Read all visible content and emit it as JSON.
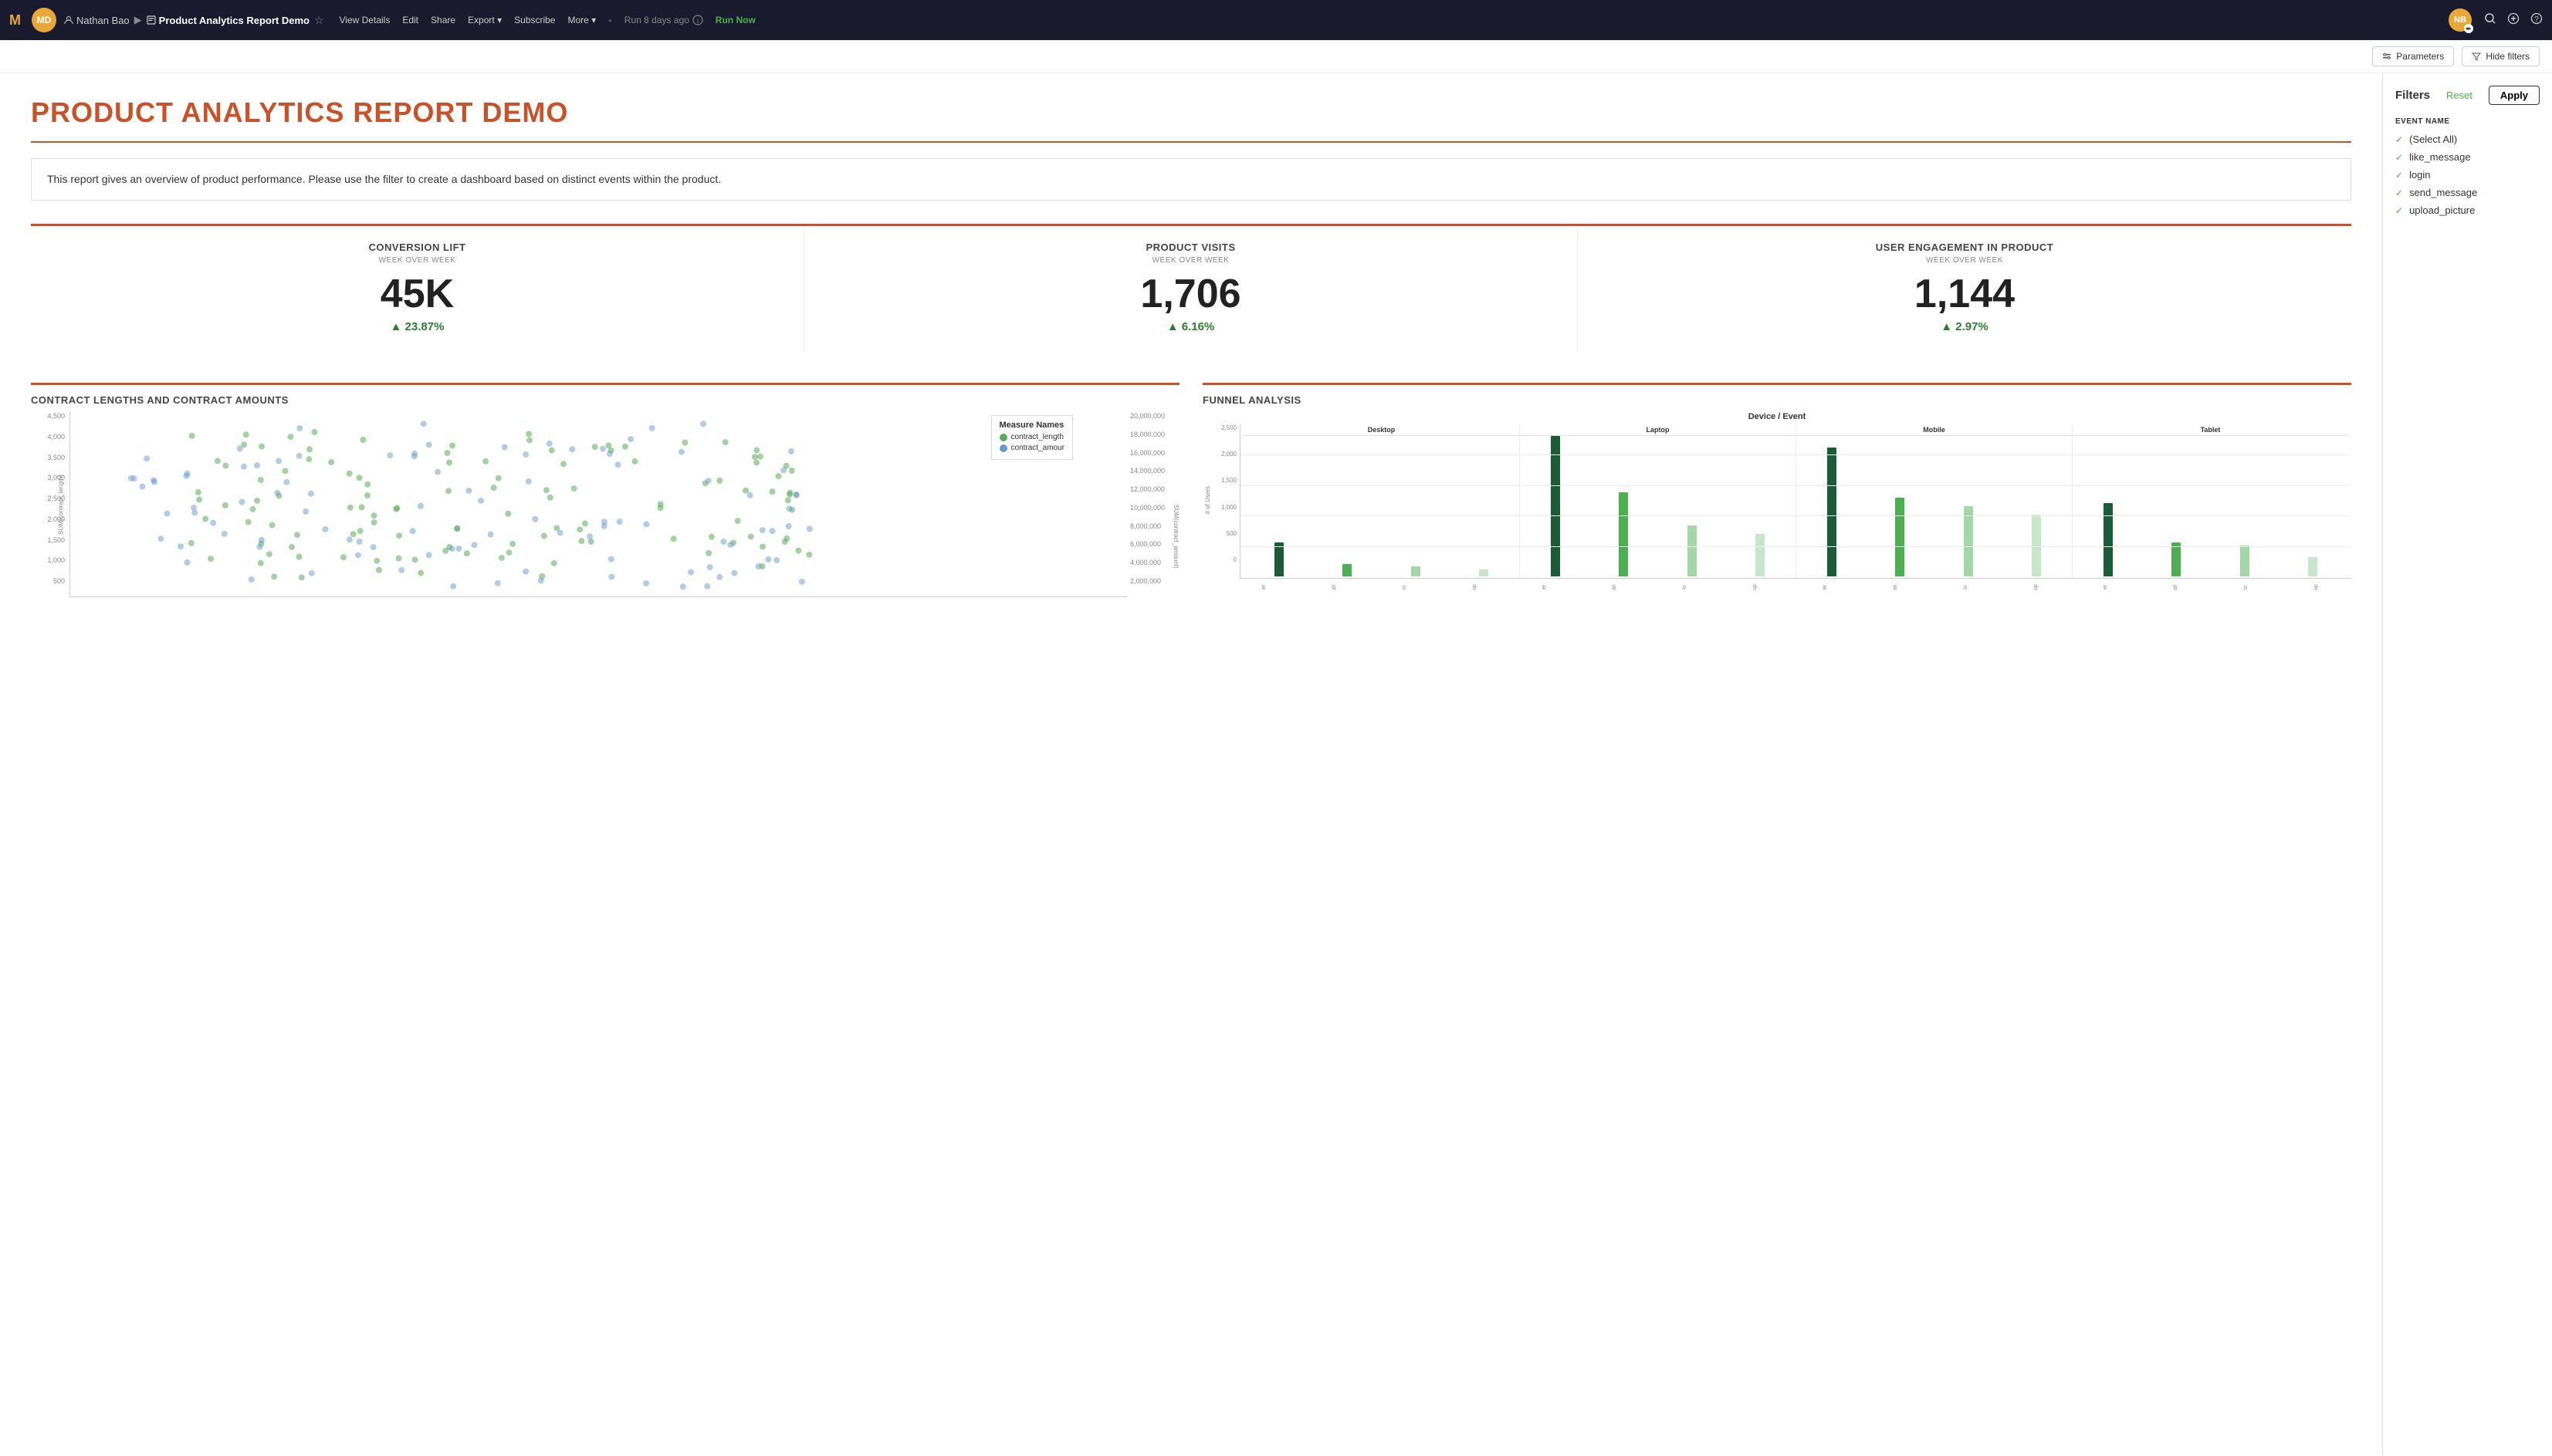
{
  "app": {
    "logo": "M",
    "user_initials": "MD",
    "user_name": "Nathan Bao",
    "report_icon": "⎘",
    "report_title": "Product Analytics Report Demo",
    "star": "☆",
    "actions": [
      "View Details",
      "Edit",
      "Share",
      "Export",
      "Subscribe",
      "More"
    ],
    "export_arrow": "▾",
    "more_arrow": "▾",
    "run_info": "Run 8 days ago",
    "run_now": "Run Now",
    "nav_initials": "NB"
  },
  "subheader": {
    "params_label": "Parameters",
    "hide_filters_label": "Hide filters"
  },
  "report": {
    "title": "PRODUCT ANALYTICS REPORT DEMO",
    "description": "This report gives an overview of product performance. Please use the filter to create a dashboard based on distinct events within the product.",
    "kpis": [
      {
        "label": "CONVERSION LIFT",
        "sublabel": "WEEK OVER WEEK",
        "value": "45K",
        "change": "▲ 23.87%"
      },
      {
        "label": "PRODUCT VISITS",
        "sublabel": "WEEK OVER WEEK",
        "value": "1,706",
        "change": "▲ 6.16%"
      },
      {
        "label": "USER ENGAGEMENT IN PRODUCT",
        "sublabel": "WEEK OVER WEEK",
        "value": "1,144",
        "change": "▲ 2.97%"
      }
    ],
    "scatter_chart": {
      "title": "CONTRACT LENGTHS AND CONTRACT AMOUNTS",
      "y_axis": [
        "4,500",
        "4,000",
        "3,500",
        "3,000",
        "2,500",
        "2,000",
        "1,500",
        "1,000",
        "500"
      ],
      "y_label": "SUM(contract_length)",
      "right_y_axis": [
        "20,000,000",
        "18,000,000",
        "16,000,000",
        "14,000,000 S",
        "12,000,000",
        "10,000,000",
        "8,000,000",
        "6,000,000",
        "4,000,000",
        "2,000,000"
      ],
      "right_y_label": "SUM(contract_amount)",
      "legend_title": "Measure Names",
      "legend_items": [
        {
          "label": "contract_length",
          "color": "#5aaa5a"
        },
        {
          "label": "contract_amour",
          "color": "#6699cc"
        }
      ]
    },
    "funnel_chart": {
      "title": "FUNNEL ANALYSIS",
      "subtitle": "Device / Event",
      "y_label": "# of Users",
      "y_axis": [
        "2,500",
        "2,000",
        "1,500",
        "1,000",
        "500",
        "0"
      ],
      "devices": [
        "Desktop",
        "Laptop",
        "Mobile",
        "Tablet"
      ],
      "event_labels": [
        "er",
        "all",
        "lo",
        "up"
      ],
      "bar_colors": {
        "dark_green": "#1a5c36",
        "mid_green": "#4caf50",
        "light_green": "#a5d6a7",
        "lightest_green": "#e8f5e9"
      },
      "bars": {
        "Desktop": [
          600,
          220,
          180,
          130
        ],
        "Laptop": [
          2700,
          1600,
          950,
          800
        ],
        "Mobile": [
          2500,
          1500,
          1300,
          1150
        ],
        "Tablet": [
          1400,
          650,
          600,
          360
        ]
      }
    }
  },
  "filters": {
    "title": "Filters",
    "reset_label": "Reset",
    "apply_label": "Apply",
    "section_label": "EVENT NAME",
    "items": [
      {
        "label": "(Select All)",
        "checked": true
      },
      {
        "label": "like_message",
        "checked": true
      },
      {
        "label": "login",
        "checked": true
      },
      {
        "label": "send_message",
        "checked": true
      },
      {
        "label": "upload_picture",
        "checked": true
      }
    ]
  }
}
